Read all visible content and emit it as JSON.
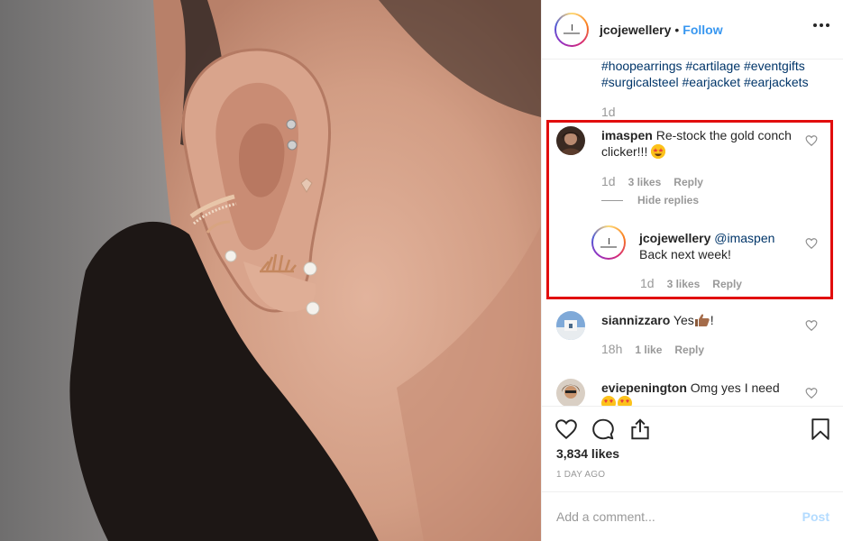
{
  "post": {
    "username": "jcojewellery",
    "separator": "•",
    "follow_label": "Follow",
    "more_icon": "more-horizontal-icon"
  },
  "caption": {
    "hashtags": "#hoopearrings #cartilage #eventgifts #surgicalsteel #earjacket #earjackets",
    "time": "1d"
  },
  "comments": [
    {
      "username": "imaspen",
      "text": "Re-stock the gold conch clicker!!!",
      "emoji": "star-struck-emoji",
      "time": "1d",
      "likes": "3 likes",
      "reply_label": "Reply",
      "hide_replies_label": "Hide replies",
      "replies": [
        {
          "username": "jcojewellery",
          "mention": "@imaspen",
          "text": "Back next week!",
          "time": "1d",
          "likes": "3 likes",
          "reply_label": "Reply"
        }
      ]
    },
    {
      "username": "siannizzaro",
      "text": "Yes",
      "emoji": "thumbs-up-emoji",
      "suffix": "!",
      "time": "18h",
      "likes": "1 like",
      "reply_label": "Reply"
    },
    {
      "username": "eviepenington",
      "text": "Omg yes I need"
    }
  ],
  "actions": {
    "likes": "3,834 likes",
    "time_ago": "1 DAY AGO"
  },
  "add_comment": {
    "placeholder": "Add a comment...",
    "post_label": "Post"
  },
  "colors": {
    "link_blue": "#3897f0",
    "hashtag_blue": "#003569",
    "highlight_red": "#e10d0d",
    "muted_gray": "#999999",
    "post_disabled": "#b3dbff"
  }
}
